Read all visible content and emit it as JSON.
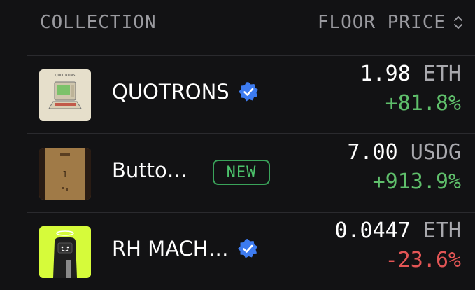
{
  "header": {
    "collection_label": "COLLECTION",
    "floor_price_label": "FLOOR PRICE",
    "sort_icon": "chevron-up-down-icon"
  },
  "rows": [
    {
      "name": "QUOTRONS",
      "verified": true,
      "badge": "",
      "price": "1.98",
      "unit": "ETH",
      "change": "+81.8%",
      "change_color": "#5fbf6b",
      "thumb_label": "QUOTRONS"
    },
    {
      "name": "Butto…",
      "verified": false,
      "badge": "NEW",
      "price": "7.00",
      "unit": "USDG",
      "change": "+913.9%",
      "change_color": "#5fbf6b",
      "thumb_label": "1"
    },
    {
      "name": "RH MACH…",
      "verified": true,
      "badge": "",
      "price": "0.0447",
      "unit": "ETH",
      "change": "-23.6%",
      "change_color": "#e25555",
      "thumb_label": ""
    }
  ],
  "colors": {
    "background": "#121214",
    "positive": "#5fbf6b",
    "negative": "#e25555",
    "verified_blue": "#3d7bf0",
    "new_badge": "#4cc26b"
  }
}
